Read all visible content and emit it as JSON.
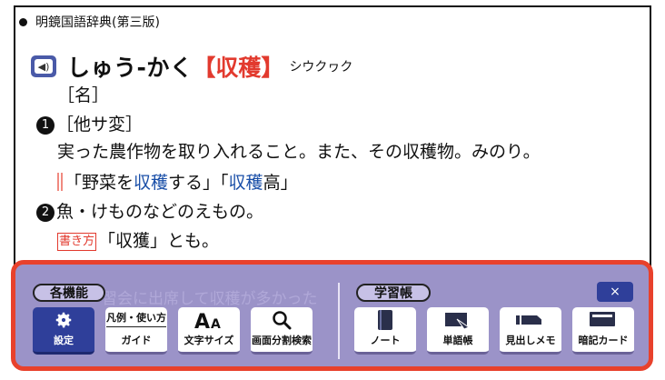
{
  "dictionary": {
    "source": "明鏡国語辞典(第三版)",
    "headword": "しゅう-かく",
    "kanji_bracket_open": "【",
    "kanji": "収穫",
    "kanji_bracket_close": "】",
    "kana_reading": "シウクヮク",
    "pos": "［名］",
    "sense1_num": "1",
    "sense1_tag": "［他サ変］",
    "definition1": "実った農作物を取り入れること。また、その収穫物。みのり。",
    "example_open": "「野菜を",
    "example_kw1": "収穫",
    "example_mid": "する」「",
    "example_kw2": "収穫",
    "example_close": "高」",
    "sense2_num": "2",
    "definition2": "魚・けものなどのえもの。",
    "writing_label": "書き方",
    "writing_note": "「収獲」とも。"
  },
  "toolbar": {
    "background_text": "習会に出席して収穫が多かった",
    "group1_label": "各機能",
    "group2_label": "学習帳",
    "close_label": "×",
    "buttons": [
      {
        "label": "設定",
        "icon": "gear-icon"
      },
      {
        "top": "凡例・使い方",
        "label": "ガイド",
        "icon": "guide-icon"
      },
      {
        "icon_text": "AA",
        "label": "文字サイズ",
        "icon": "font-size-icon"
      },
      {
        "label": "画面分割検索",
        "icon": "search-icon"
      },
      {
        "label": "ノート",
        "icon": "notebook-icon"
      },
      {
        "label": "単語帳",
        "icon": "vocabulary-card-icon"
      },
      {
        "label": "見出しメモ",
        "icon": "headword-memo-icon"
      },
      {
        "label": "暗記カード",
        "icon": "flashcard-icon"
      }
    ]
  },
  "colors": {
    "accent_red": "#e23a2e",
    "toolbar_bg": "#9b93c8",
    "button_active": "#2f3f9a",
    "keyword_blue": "#1a4fa8"
  }
}
